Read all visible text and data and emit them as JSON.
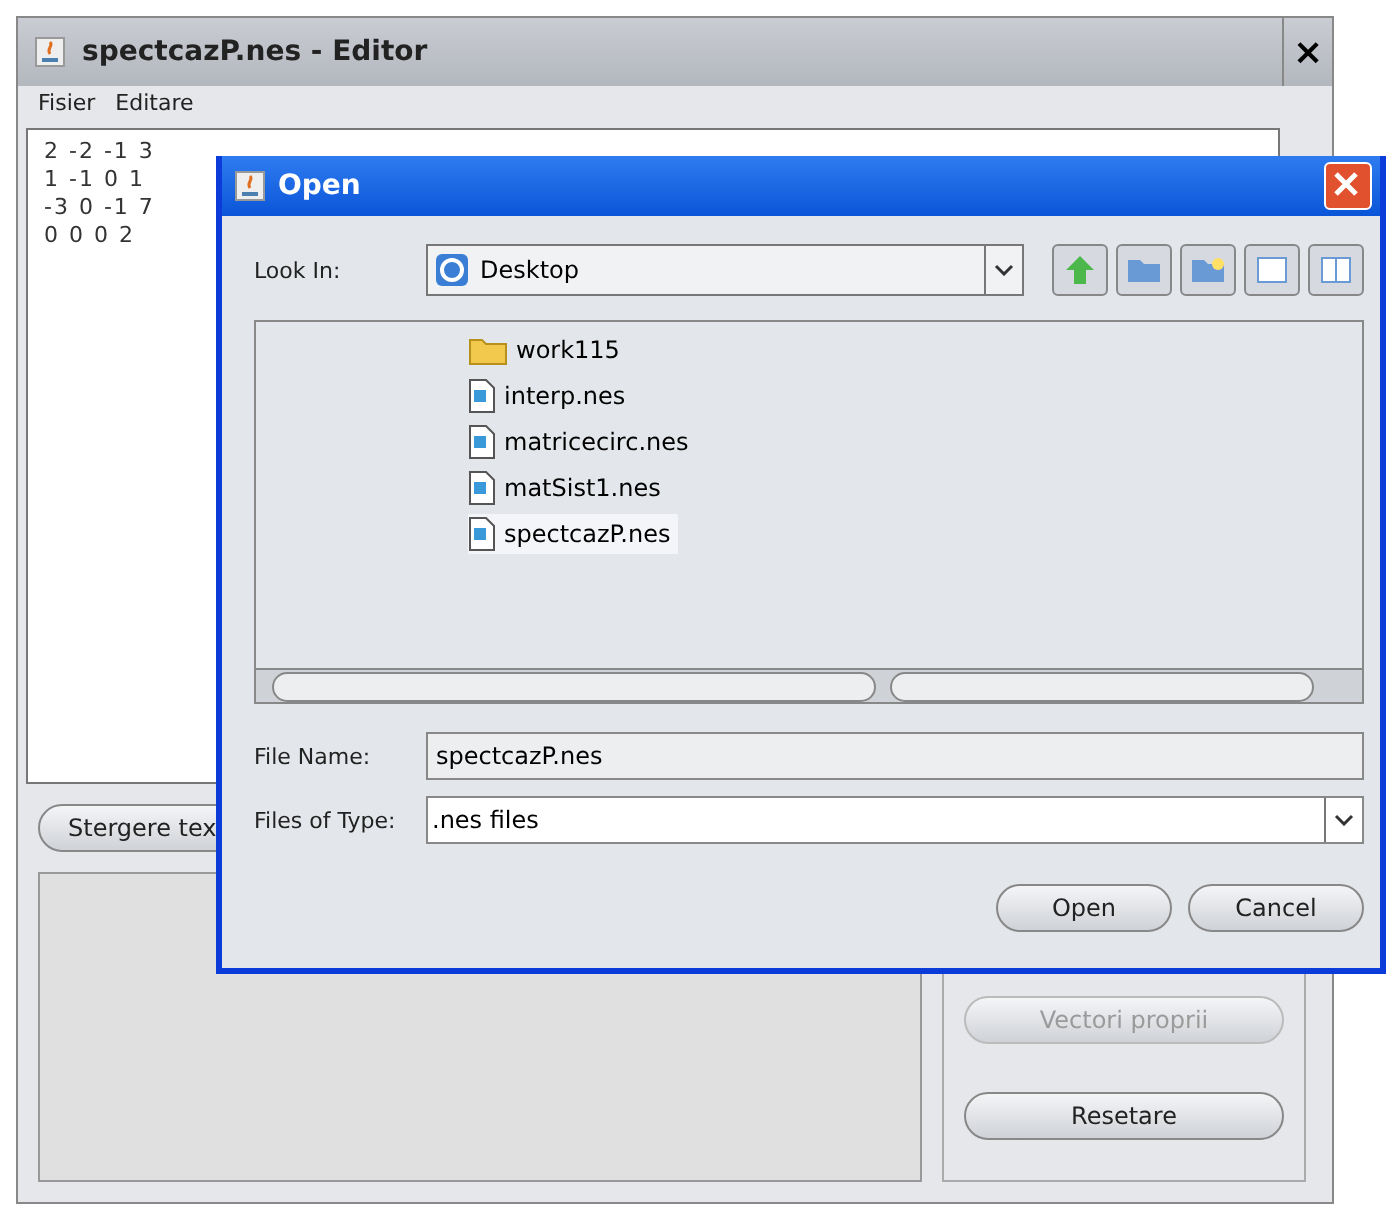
{
  "editor": {
    "title": "spectcazP.nes - Editor",
    "close": "×",
    "menu": [
      "Fisier",
      "Editare"
    ],
    "text_lines": [
      "2 -2 -1 3",
      "1 -1 0 1",
      "-3 0 -1 7",
      "0 0 0 2"
    ],
    "left_button": "Stergere tex",
    "side_buttons": [
      {
        "label": "Vectori proprii",
        "disabled": true
      },
      {
        "label": "Resetare",
        "disabled": false
      }
    ]
  },
  "dialog": {
    "title": "Open",
    "look_in": {
      "label": "Look In:",
      "value": "Desktop"
    },
    "files": [
      {
        "name": "work115",
        "kind": "folder",
        "selected": false
      },
      {
        "name": "interp.nes",
        "kind": "file",
        "selected": false
      },
      {
        "name": "matricecirc.nes",
        "kind": "file",
        "selected": false
      },
      {
        "name": "matSist1.nes",
        "kind": "file",
        "selected": false
      },
      {
        "name": "spectcazP.nes",
        "kind": "file",
        "selected": true
      }
    ],
    "file_name": {
      "label": "File Name:",
      "value": "spectcazP.nes"
    },
    "file_type": {
      "label": "Files of Type:",
      "value": ".nes files"
    },
    "buttons": [
      "Open",
      "Cancel"
    ]
  }
}
